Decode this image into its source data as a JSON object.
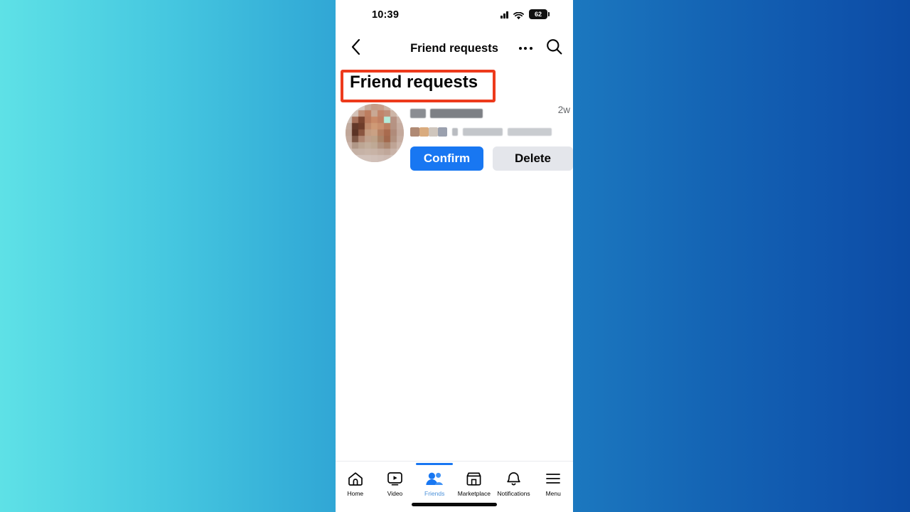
{
  "background": {
    "gradient_from": "#5EE1E6",
    "gradient_to": "#0C4BA4"
  },
  "status_bar": {
    "time": "10:39",
    "battery_percent": "62",
    "signal_icon": "cellular-signal-icon",
    "wifi_icon": "wifi-icon",
    "battery_icon": "battery-icon"
  },
  "app_bar": {
    "title": "Friend requests",
    "back_icon": "back-chevron-icon",
    "more_icon": "more-options-icon",
    "search_icon": "search-icon"
  },
  "section": {
    "heading": "Friend requests",
    "annotation_color": "#ED3A1C"
  },
  "request": {
    "avatar_alt": "profile-photo-blurred",
    "name": "",
    "name_redacted": true,
    "mutual_text": "",
    "mutual_redacted": true,
    "timestamp": "2w",
    "confirm_label": "Confirm",
    "delete_label": "Delete",
    "confirm_color": "#1877F2",
    "delete_color": "#E4E6EB"
  },
  "bottom_nav": {
    "active_index": 2,
    "accent_color": "#1877F2",
    "items": [
      {
        "label": "Home",
        "icon": "home-icon"
      },
      {
        "label": "Video",
        "icon": "video-icon"
      },
      {
        "label": "Friends",
        "icon": "friends-icon"
      },
      {
        "label": "Marketplace",
        "icon": "marketplace-icon"
      },
      {
        "label": "Notifications",
        "icon": "bell-icon"
      },
      {
        "label": "Menu",
        "icon": "hamburger-menu-icon"
      }
    ]
  }
}
